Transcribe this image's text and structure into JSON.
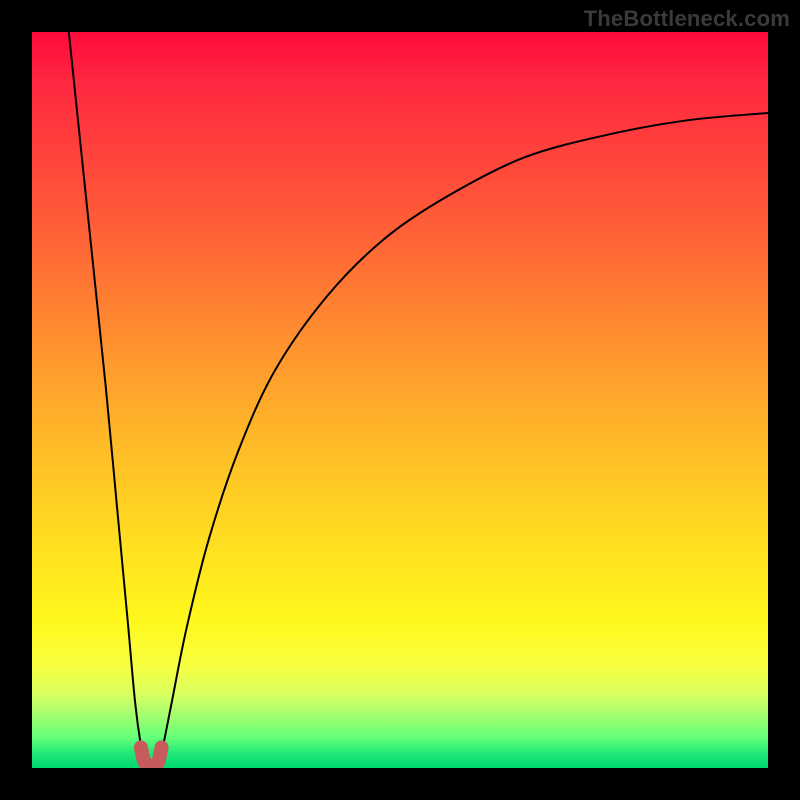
{
  "watermark": {
    "text": "TheBottleneck.com"
  },
  "chart_data": {
    "type": "line",
    "title": "",
    "xlabel": "",
    "ylabel": "",
    "xlim": [
      0,
      1
    ],
    "ylim": [
      0,
      1
    ],
    "grid": false,
    "legend": false,
    "annotations": [],
    "background_gradient": {
      "orientation": "vertical",
      "stops": [
        {
          "t": 0.0,
          "color": "#ff0a3b"
        },
        {
          "t": 0.25,
          "color": "#ff5a38"
        },
        {
          "t": 0.55,
          "color": "#ffb828"
        },
        {
          "t": 0.8,
          "color": "#fff81c"
        },
        {
          "t": 0.93,
          "color": "#a0ff70"
        },
        {
          "t": 1.0,
          "color": "#00d870"
        }
      ]
    },
    "series": [
      {
        "name": "bottleneck-curve-left",
        "color": "#000000",
        "x": [
          0.05,
          0.075,
          0.1,
          0.115,
          0.13,
          0.14,
          0.148,
          0.153
        ],
        "y": [
          1.0,
          0.76,
          0.52,
          0.36,
          0.2,
          0.09,
          0.03,
          0.01
        ]
      },
      {
        "name": "bottleneck-curve-right",
        "color": "#000000",
        "x": [
          0.172,
          0.178,
          0.19,
          0.21,
          0.24,
          0.28,
          0.33,
          0.4,
          0.48,
          0.57,
          0.67,
          0.78,
          0.89,
          1.0
        ],
        "y": [
          0.01,
          0.03,
          0.09,
          0.19,
          0.31,
          0.43,
          0.54,
          0.64,
          0.72,
          0.78,
          0.83,
          0.86,
          0.88,
          0.89
        ]
      },
      {
        "name": "bottleneck-base-u",
        "color": "#c75a5a",
        "stroke_width_px": 14,
        "x": [
          0.148,
          0.152,
          0.158,
          0.163,
          0.168,
          0.172,
          0.176
        ],
        "y": [
          0.028,
          0.01,
          0.004,
          0.003,
          0.004,
          0.01,
          0.028
        ]
      }
    ]
  }
}
